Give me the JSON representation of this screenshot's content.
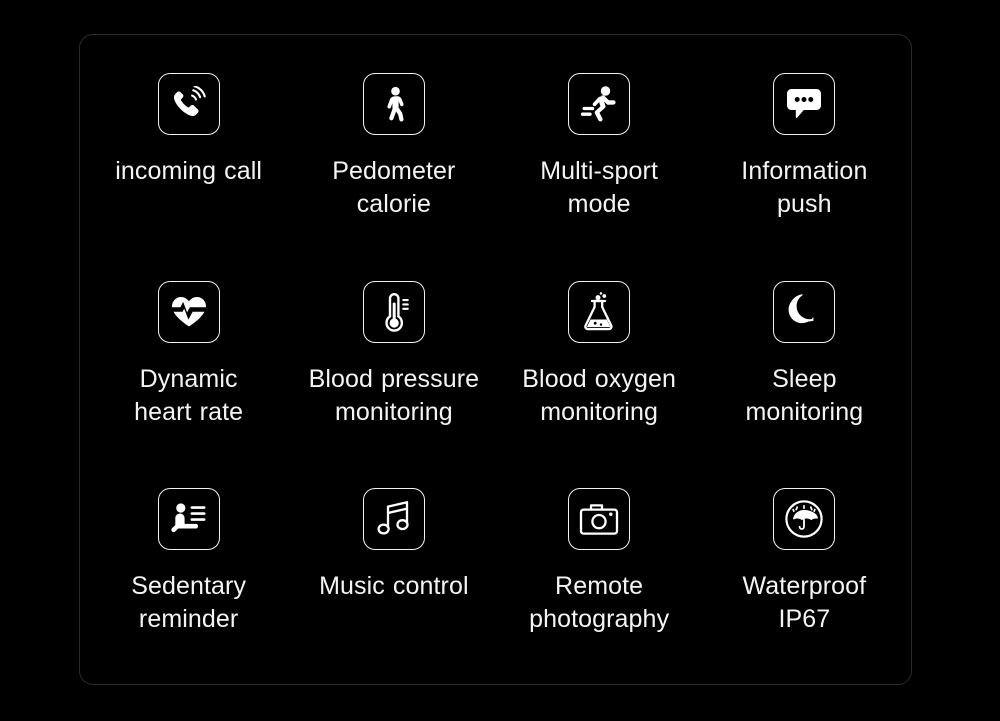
{
  "page": {
    "background_color": "#000000",
    "panel_border_color": "#2b2b2b",
    "text_color": "#f4f4f4",
    "icon_color": "#ffffff"
  },
  "features": [
    {
      "icon": "incoming-call-icon",
      "line1": "incoming call",
      "line2": ""
    },
    {
      "icon": "pedometer-walking-person-icon",
      "line1": "Pedometer",
      "line2": "calorie"
    },
    {
      "icon": "multi-sport-running-person-icon",
      "line1": "Multi-sport",
      "line2": "mode"
    },
    {
      "icon": "information-push-speech-bubble-icon",
      "line1": "Information",
      "line2": "push"
    },
    {
      "icon": "dynamic-heart-rate-icon",
      "line1": "Dynamic",
      "line2": "heart rate"
    },
    {
      "icon": "blood-pressure-thermometer-icon",
      "line1": "Blood pressure",
      "line2": "monitoring"
    },
    {
      "icon": "blood-oxygen-flask-icon",
      "line1": "Blood oxygen",
      "line2": "monitoring"
    },
    {
      "icon": "sleep-moon-icon",
      "line1": "Sleep",
      "line2": "monitoring"
    },
    {
      "icon": "sedentary-reminder-seated-person-icon",
      "line1": "Sedentary",
      "line2": "reminder"
    },
    {
      "icon": "music-control-note-icon",
      "line1": "Music control",
      "line2": ""
    },
    {
      "icon": "remote-photography-camera-icon",
      "line1": "Remote",
      "line2": "photography"
    },
    {
      "icon": "waterproof-umbrella-icon",
      "line1": "Waterproof",
      "line2": "IP67"
    }
  ]
}
